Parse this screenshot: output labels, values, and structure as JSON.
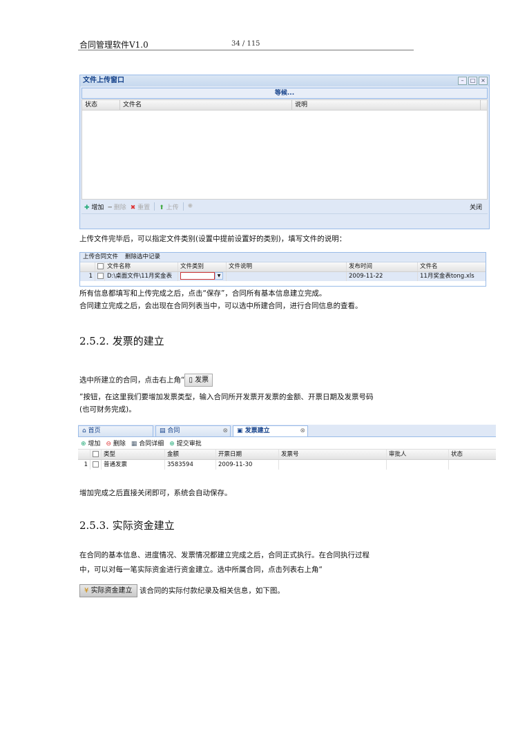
{
  "header": {
    "title": "合同管理软件V1.0",
    "page": "34 / 115"
  },
  "upload_window": {
    "title": "文件上传窗口",
    "wait_text": "等候...",
    "columns": [
      "状态",
      "文件名",
      "说明"
    ],
    "toolbar": {
      "add": "增加",
      "delete": "删除",
      "reset": "重置",
      "upload": "上传",
      "close": "关闭"
    }
  },
  "para1": "上传文件完毕后，可以指定文件类别(设置中提前设置好的类别)，填写文件的说明：",
  "file_grid": {
    "toolbar": [
      "上传合同文件",
      "删除选中记录"
    ],
    "columns": [
      "文件名称",
      "文件类别",
      "文件说明",
      "发布时间",
      "文件名"
    ],
    "row": {
      "num": "1",
      "name": "D:\\桌面文件\\11月奖金表",
      "type": "",
      "desc": "",
      "date": "2009-11-22",
      "file": "11月奖金表tong.xls"
    }
  },
  "para2": "所有信息都填写和上传完成之后，点击“保存”，合同所有基本信息建立完成。",
  "para3": "合同建立完成之后，会出现在合同列表当中，可以选中所建合同，进行合同信息的查看。",
  "section1": {
    "num": "2.5.2.",
    "title": "发票的建立"
  },
  "para4_a": "选中所建立的合同，点击右上角“",
  "invoice_btn": "发票",
  "para4_b": "”按钮，在这里我们要增加发票类型，输入合同所开发票开发票的金额、开票日期及发票号码",
  "para4_c": "(也可财务完成)。",
  "invoice_panel": {
    "tabs": [
      "首页",
      "合同",
      "发票建立"
    ],
    "toolbar": {
      "add": "增加",
      "delete": "删除",
      "detail": "合同详细",
      "submit": "提交审批"
    },
    "columns": [
      "类型",
      "金额",
      "开票日期",
      "发票号",
      "审批人",
      "状态"
    ],
    "row": {
      "num": "1",
      "type": "普通发票",
      "amount": "3583594",
      "date": "2009-11-30",
      "invoice_no": "",
      "approver": "",
      "status": ""
    }
  },
  "para5": "增加完成之后直接关闭即可，系统会自动保存。",
  "section2": {
    "num": "2.5.3.",
    "title": "实际资金建立"
  },
  "para6_a": "在合同的基本信息、进度情况、发票情况都建立完成之后，合同正式执行。在合同执行过程",
  "para6_b": "中，可以对每一笔实际资金进行资金建立。选中所属合同，点击列表右上角“",
  "fund_btn": "实际资金建立",
  "para6_c": "该合同的实际付款纪录及相关信息，如下图。"
}
